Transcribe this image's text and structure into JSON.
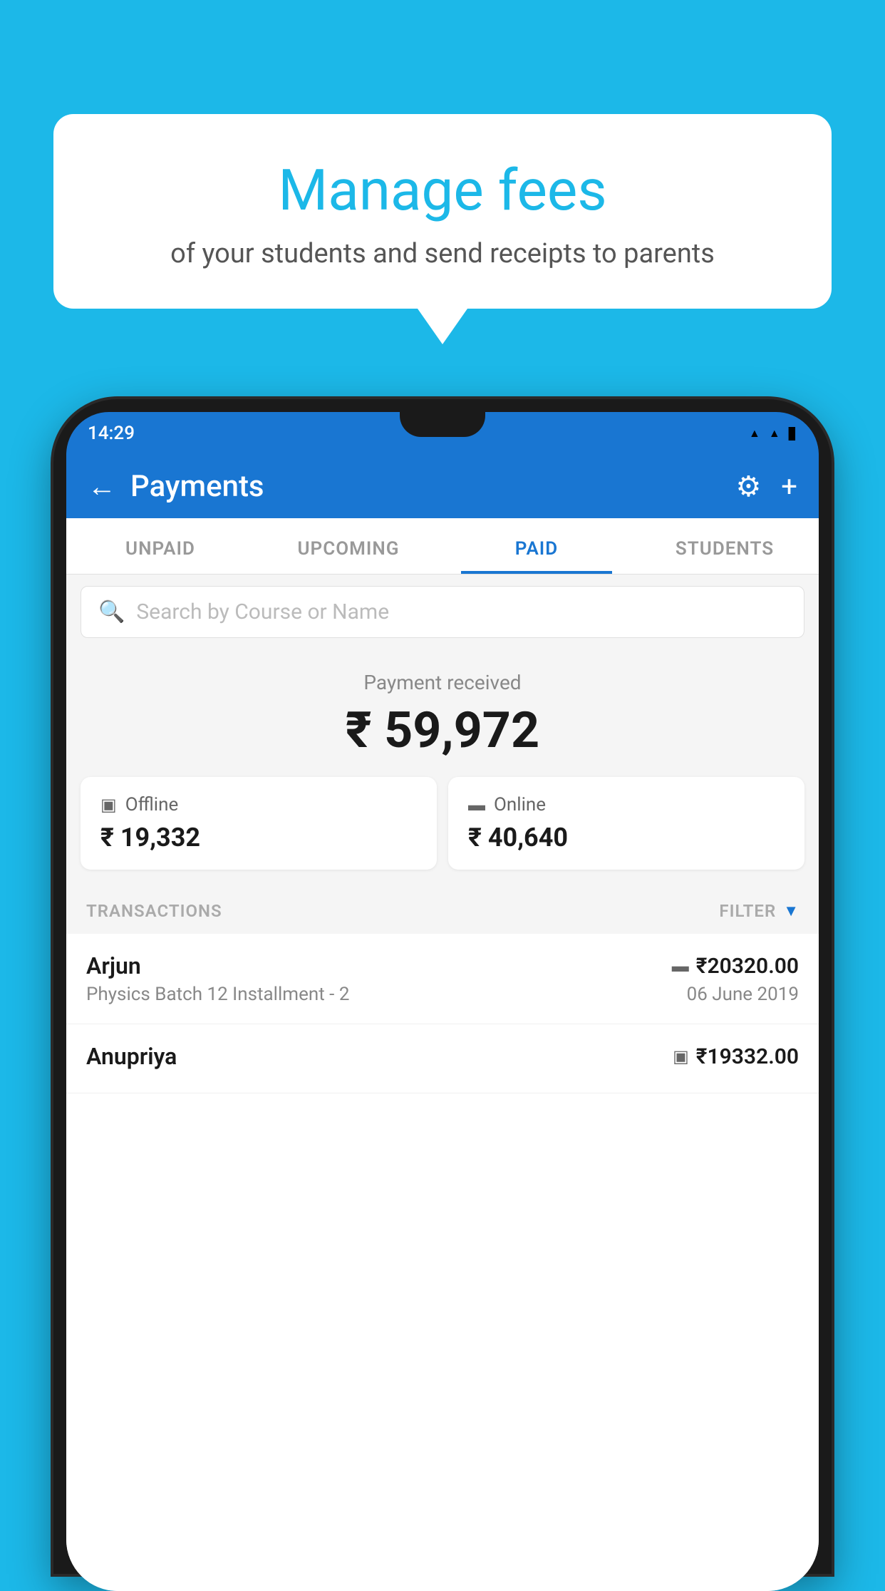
{
  "background": {
    "color": "#1cb8e8"
  },
  "speech_bubble": {
    "title": "Manage fees",
    "subtitle": "of your students and send receipts to parents"
  },
  "phone": {
    "status_bar": {
      "time": "14:29"
    },
    "header": {
      "title": "Payments",
      "back_label": "←",
      "gear_label": "⚙",
      "plus_label": "+"
    },
    "tabs": [
      {
        "label": "UNPAID",
        "active": false
      },
      {
        "label": "UPCOMING",
        "active": false
      },
      {
        "label": "PAID",
        "active": true
      },
      {
        "label": "STUDENTS",
        "active": false
      }
    ],
    "search": {
      "placeholder": "Search by Course or Name"
    },
    "payment_summary": {
      "label": "Payment received",
      "amount": "₹ 59,972",
      "offline": {
        "label": "Offline",
        "amount": "₹ 19,332"
      },
      "online": {
        "label": "Online",
        "amount": "₹ 40,640"
      }
    },
    "transactions": {
      "label": "TRANSACTIONS",
      "filter_label": "FILTER",
      "items": [
        {
          "name": "Arjun",
          "course": "Physics Batch 12 Installment - 2",
          "amount": "₹20320.00",
          "date": "06 June 2019",
          "payment_type": "online"
        },
        {
          "name": "Anupriya",
          "course": "",
          "amount": "₹19332.00",
          "date": "",
          "payment_type": "offline"
        }
      ]
    }
  }
}
